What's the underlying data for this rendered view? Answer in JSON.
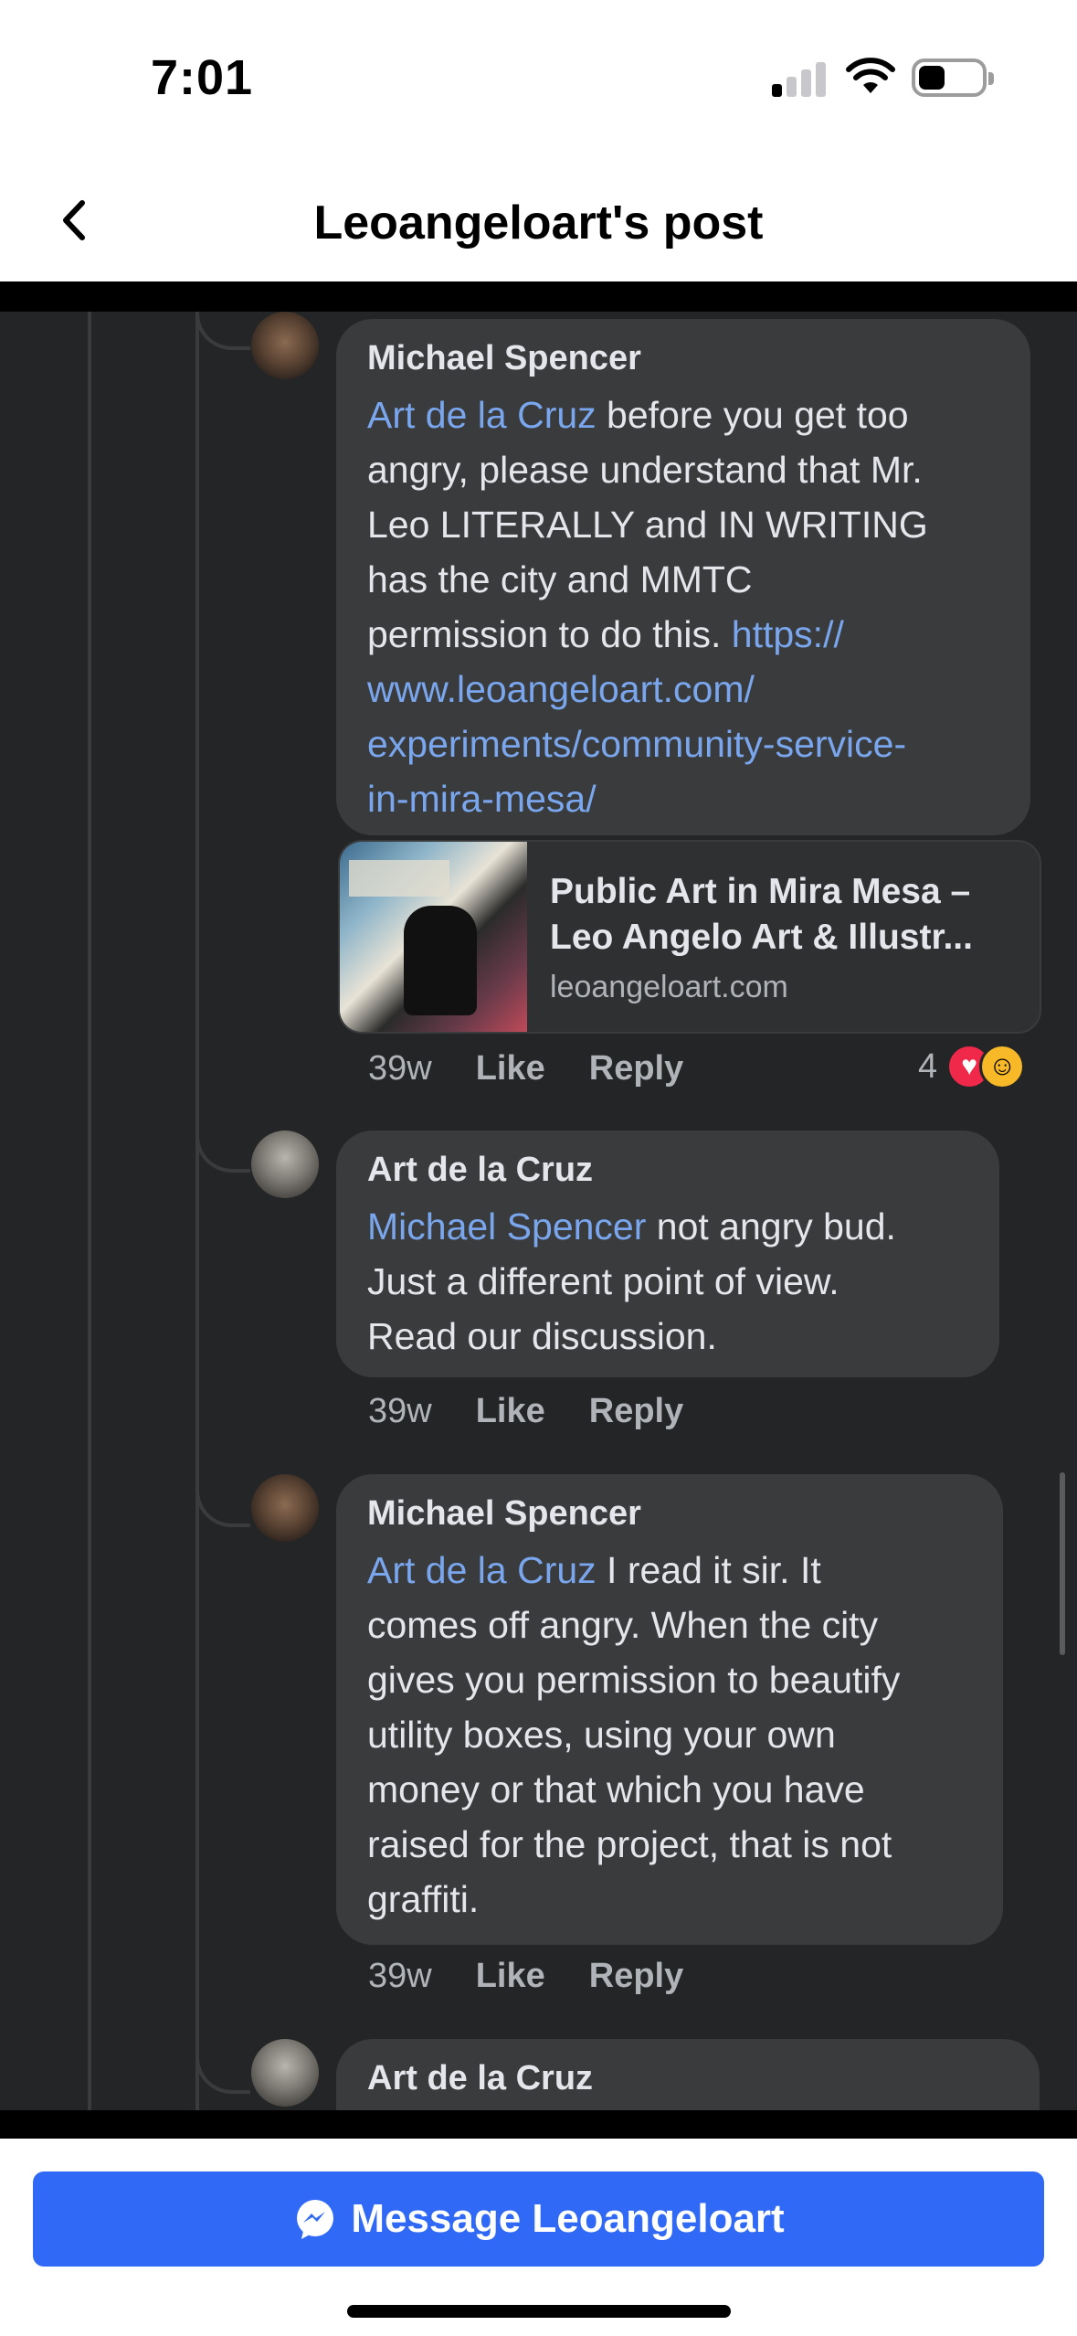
{
  "status": {
    "time": "7:01"
  },
  "nav": {
    "title": "Leoangeloart's post"
  },
  "comments": [
    {
      "author": "Michael Spencer",
      "mention": "Art de la Cruz",
      "line1_rest": " before you get too",
      "lines": [
        "angry, please understand that Mr.",
        "Leo LITERALLY and IN WRITING",
        "has the city and MMTC"
      ],
      "pre_link": "permission to do this. ",
      "link_lines": [
        "https://",
        "www.leoangeloart.com/",
        "experiments/community-service-",
        "in-mira-mesa/"
      ],
      "age": "39w",
      "like": "Like",
      "reply": "Reply",
      "reaction_count": "4"
    },
    {
      "author": "Art de la Cruz",
      "mention": "Michael Spencer",
      "line1_rest": " not angry bud.",
      "lines": [
        "Just a different point of view.",
        "Read our discussion."
      ],
      "age": "39w",
      "like": "Like",
      "reply": "Reply"
    },
    {
      "author": "Michael Spencer",
      "mention": "Art de la Cruz",
      "line1_rest": " I read it sir. It",
      "lines": [
        "comes off angry. When the city",
        "gives you permission to beautify",
        "utility boxes, using your own",
        "money or that which you have",
        "raised for the project, that is not",
        "graffiti."
      ],
      "age": "39w",
      "like": "Like",
      "reply": "Reply"
    },
    {
      "author": "Art de la Cruz"
    }
  ],
  "link_preview": {
    "title_line1": "Public Art in Mira Mesa –",
    "title_line2": "Leo Angelo Art & Illustr...",
    "domain": "leoangeloart.com"
  },
  "bottom": {
    "message_button": "Message Leoangeloart"
  }
}
